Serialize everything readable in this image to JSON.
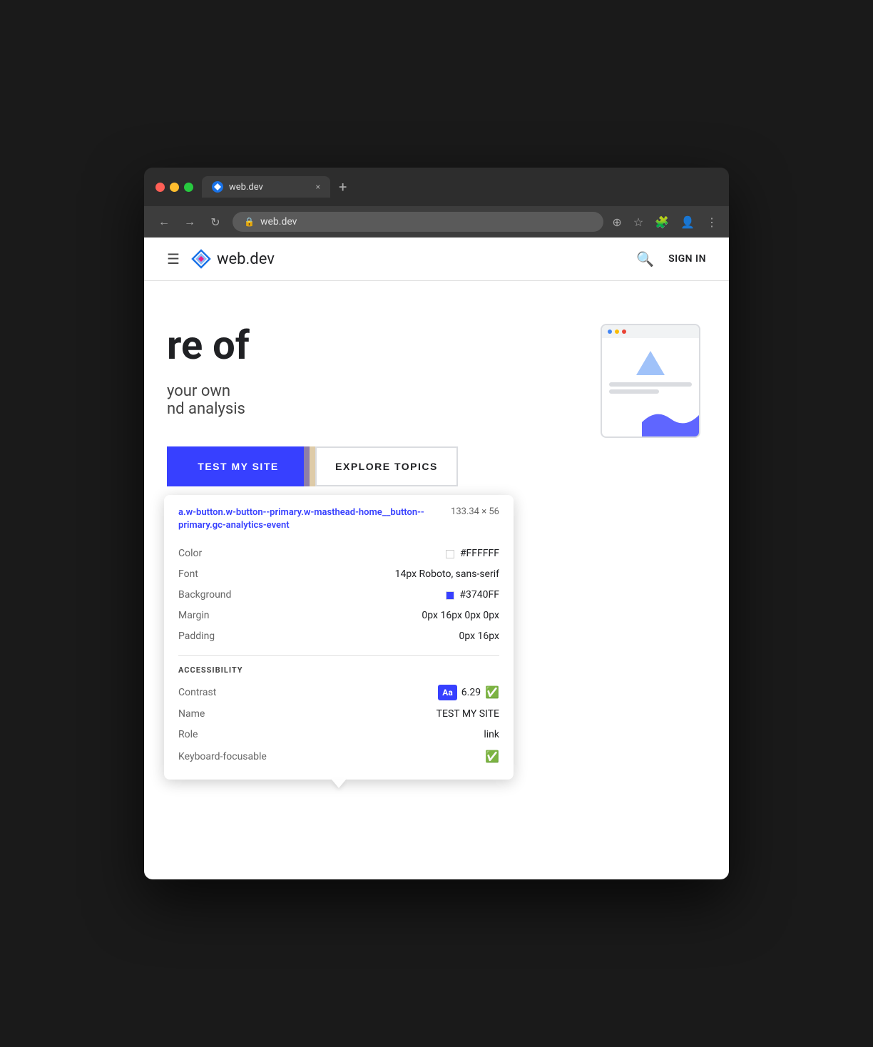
{
  "browser": {
    "tab": {
      "title": "web.dev",
      "close": "×"
    },
    "new_tab": "+",
    "nav": {
      "back": "←",
      "forward": "→",
      "reload": "↻",
      "address": "web.dev"
    }
  },
  "site_header": {
    "logo_text": "web.dev",
    "search_label": "search",
    "sign_in": "SIGN IN"
  },
  "hero": {
    "heading_partial": "re of",
    "subheading_partial1": "your own",
    "subheading_partial2": "nd analysis"
  },
  "buttons": {
    "primary": "TEST MY SITE",
    "secondary": "EXPLORE TOPICS"
  },
  "inspector": {
    "selector": "a.w-button.w-button--primary.w-masthead-home__button--primary.gc-analytics-event",
    "dimensions": "133.34 × 56",
    "properties": {
      "color_label": "Color",
      "color_value": "#FFFFFF",
      "font_label": "Font",
      "font_value": "14px Roboto, sans-serif",
      "background_label": "Background",
      "background_value": "#3740FF",
      "background_color_hex": "#3740FF",
      "margin_label": "Margin",
      "margin_value": "0px 16px 0px 0px",
      "padding_label": "Padding",
      "padding_value": "0px 16px"
    },
    "accessibility": {
      "section_label": "ACCESSIBILITY",
      "contrast_label": "Contrast",
      "contrast_badge": "Aa",
      "contrast_value": "6.29",
      "name_label": "Name",
      "name_value": "TEST MY SITE",
      "role_label": "Role",
      "role_value": "link",
      "keyboard_label": "Keyboard-focusable"
    }
  }
}
